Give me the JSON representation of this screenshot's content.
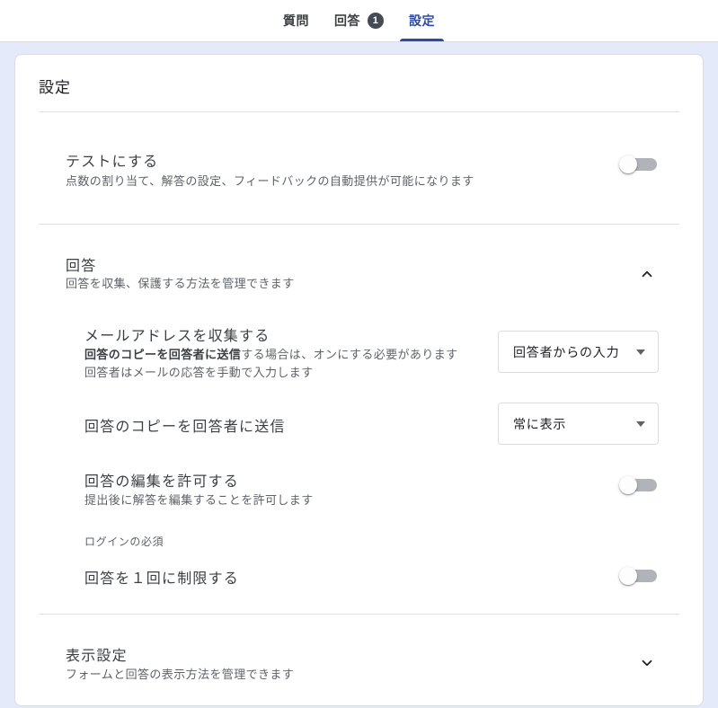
{
  "tabs": {
    "questions": "質問",
    "responses": "回答",
    "responses_badge": "1",
    "settings": "設定"
  },
  "page": {
    "title": "設定"
  },
  "quiz_section": {
    "title": "テストにする",
    "description": "点数の割り当て、解答の設定、フィードバックの自動提供が可能になります",
    "toggle_state": "off"
  },
  "responses_section": {
    "title": "回答",
    "description": "回答を収集、保護する方法を管理できます",
    "collapse_state": "expanded",
    "collect_email": {
      "title": "メールアドレスを収集する",
      "description_bold": "回答のコピーを回答者に送信",
      "description_rest": "する場合は、オンにする必要があります",
      "description_line2": "回答者はメールの応答を手動で入力します",
      "dropdown_value": "回答者からの入力"
    },
    "send_copy": {
      "title": "回答のコピーを回答者に送信",
      "dropdown_value": "常に表示"
    },
    "allow_edit": {
      "title": "回答の編集を許可する",
      "description": "提出後に解答を編集することを許可します",
      "toggle_state": "off"
    },
    "login_required_label": "ログインの必須",
    "limit_one_response": {
      "title": "回答を１回に制限する",
      "toggle_state": "off"
    }
  },
  "presentation_section": {
    "title": "表示設定",
    "description": "フォームと回答の表示方法を管理できます",
    "collapse_state": "collapsed"
  },
  "colors": {
    "accent": "#2f4b9c",
    "badge_bg": "#454b54",
    "page_bg": "#e4eafa",
    "divider": "#e0e0e0",
    "toggle_off_track": "#b0b3b8"
  }
}
